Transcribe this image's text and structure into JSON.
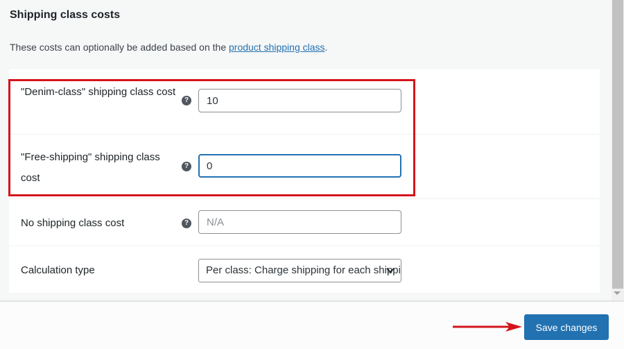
{
  "section": {
    "title": "Shipping class costs",
    "description_prefix": "These costs can optionally be added based on the ",
    "description_link": "product shipping class",
    "description_suffix": "."
  },
  "fields": [
    {
      "label": "\"Denim-class\" shipping class cost",
      "help_icon": "question-circle-icon",
      "value": "10",
      "placeholder": ""
    },
    {
      "label": "\"Free-shipping\" shipping class cost",
      "help_icon": "question-circle-icon",
      "value": "0",
      "placeholder": "",
      "focused": true
    },
    {
      "label": "No shipping class cost",
      "help_icon": "question-circle-icon",
      "value": "",
      "placeholder": "N/A"
    }
  ],
  "calculation": {
    "label": "Calculation type",
    "selected": "Per class: Charge shipping for each shipping class individually"
  },
  "help_glyph": "?",
  "chevron_glyph": "⌄",
  "footer": {
    "save_label": "Save changes"
  },
  "colors": {
    "accent": "#2271b1",
    "highlight": "#d3141b"
  }
}
